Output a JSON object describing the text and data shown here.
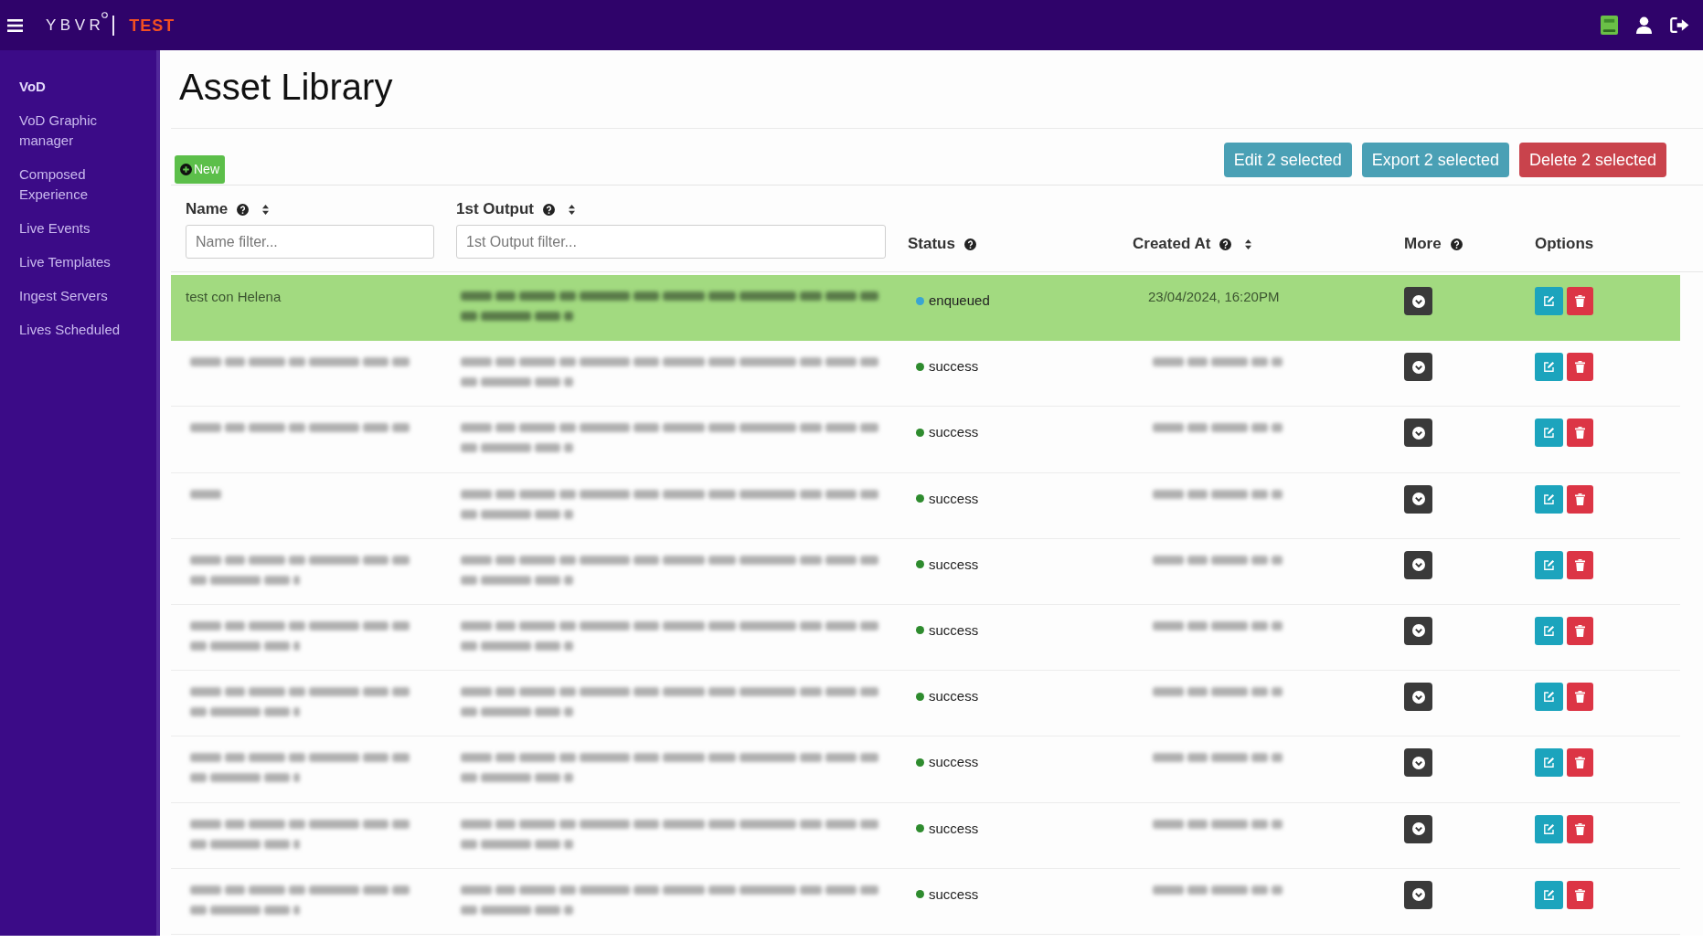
{
  "top_bar": {
    "logo": "YBVR",
    "environment": "TEST"
  },
  "sidebar": {
    "items": [
      {
        "label": "VoD",
        "selected": true
      },
      {
        "label": "VoD Graphic manager",
        "selected": false
      },
      {
        "label": "Composed Experience",
        "selected": false
      },
      {
        "label": "Live Events",
        "selected": false
      },
      {
        "label": "Live Templates",
        "selected": false
      },
      {
        "label": "Ingest Servers",
        "selected": false
      },
      {
        "label": "Lives Scheduled",
        "selected": false
      }
    ]
  },
  "page": {
    "title": "Asset Library"
  },
  "toolbar": {
    "new_button": "New",
    "actions": [
      {
        "label": "Edit 2 selected",
        "kind": "edit"
      },
      {
        "label": "Export 2 selected",
        "kind": "export"
      },
      {
        "label": "Delete 2 selected",
        "kind": "delete"
      }
    ]
  },
  "table": {
    "columns": [
      {
        "label": "Name",
        "help": true,
        "sortable": true,
        "filter": {
          "placeholder": "Name filter..."
        }
      },
      {
        "label": "1st Output",
        "help": true,
        "sortable": true,
        "filter": {
          "placeholder": "1st Output filter..."
        }
      },
      {
        "label": "Status",
        "help": true,
        "sortable": false
      },
      {
        "label": "Created At",
        "help": true,
        "sortable": true
      },
      {
        "label": "More",
        "help": true,
        "sortable": false
      },
      {
        "label": "Options",
        "help": false,
        "sortable": false
      }
    ],
    "rows": [
      {
        "selected": true,
        "name": {
          "kind": "text",
          "text": "test con Helena"
        },
        "output": {
          "kind": "redacted_block"
        },
        "status": {
          "label": "enqueued",
          "color": "#3aa5d2"
        },
        "created_at": {
          "kind": "text",
          "text": "23/04/2024, 16:20PM"
        }
      },
      {
        "selected": false,
        "name": {
          "kind": "redacted"
        },
        "output": {
          "kind": "redacted_block"
        },
        "status": {
          "label": "success",
          "color": "#2e8b2e"
        },
        "created_at": {
          "kind": "redacted"
        }
      },
      {
        "selected": false,
        "name": {
          "kind": "redacted"
        },
        "output": {
          "kind": "redacted_block"
        },
        "status": {
          "label": "success",
          "color": "#2e8b2e"
        },
        "created_at": {
          "kind": "redacted"
        }
      },
      {
        "selected": false,
        "name": {
          "kind": "redacted_short"
        },
        "output": {
          "kind": "redacted_block"
        },
        "status": {
          "label": "success",
          "color": "#2e8b2e"
        },
        "created_at": {
          "kind": "redacted"
        }
      },
      {
        "selected": false,
        "name": {
          "kind": "redacted_block"
        },
        "output": {
          "kind": "redacted_block"
        },
        "status": {
          "label": "success",
          "color": "#2e8b2e"
        },
        "created_at": {
          "kind": "redacted"
        }
      },
      {
        "selected": false,
        "name": {
          "kind": "redacted_block"
        },
        "output": {
          "kind": "redacted_block"
        },
        "status": {
          "label": "success",
          "color": "#2e8b2e"
        },
        "created_at": {
          "kind": "redacted"
        }
      },
      {
        "selected": false,
        "name": {
          "kind": "redacted_block"
        },
        "output": {
          "kind": "redacted_block"
        },
        "status": {
          "label": "success",
          "color": "#2e8b2e"
        },
        "created_at": {
          "kind": "redacted"
        }
      },
      {
        "selected": false,
        "name": {
          "kind": "redacted_block"
        },
        "output": {
          "kind": "redacted_block"
        },
        "status": {
          "label": "success",
          "color": "#2e8b2e"
        },
        "created_at": {
          "kind": "redacted"
        }
      },
      {
        "selected": false,
        "name": {
          "kind": "redacted_block"
        },
        "output": {
          "kind": "redacted_block"
        },
        "status": {
          "label": "success",
          "color": "#2e8b2e"
        },
        "created_at": {
          "kind": "redacted"
        }
      },
      {
        "selected": false,
        "name": {
          "kind": "redacted_block"
        },
        "output": {
          "kind": "redacted_block"
        },
        "status": {
          "label": "success",
          "color": "#2e8b2e"
        },
        "created_at": {
          "kind": "redacted"
        }
      }
    ]
  }
}
